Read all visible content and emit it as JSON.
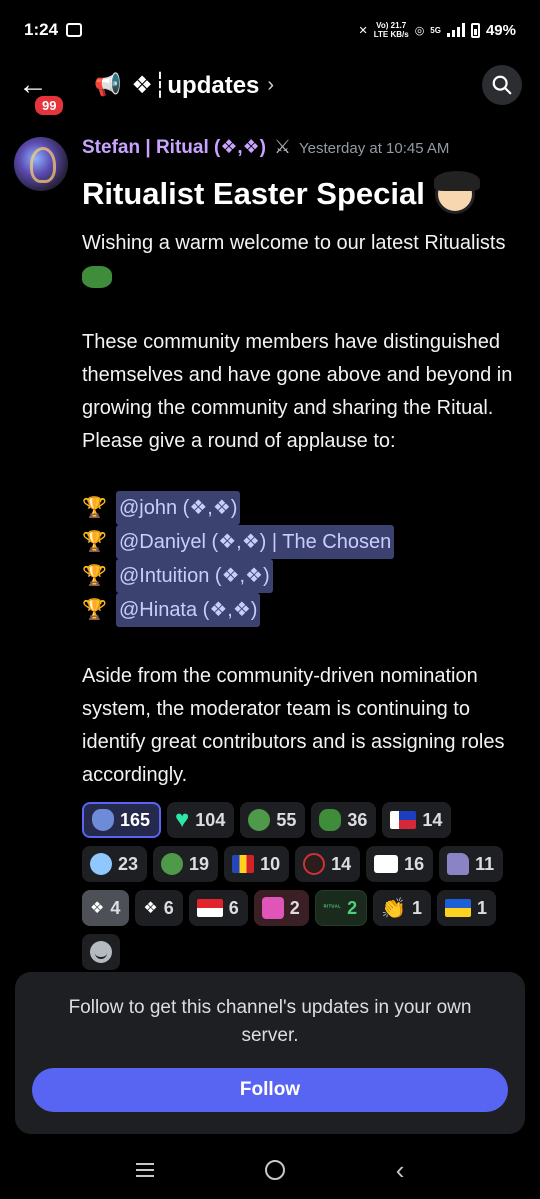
{
  "status_bar": {
    "time": "1:24",
    "network_top": "Vo) 21.7",
    "network_bottom": "LTE KB/s",
    "signal_label": "5G",
    "battery": "49%"
  },
  "header": {
    "unread_badge": "99",
    "channel_name": "❖┆updates",
    "chevron": "›"
  },
  "message": {
    "author": "Stefan | Ritual (❖,❖)",
    "author_badge": "⚔",
    "timestamp": "Yesterday at 10:45 AM",
    "title": "Ritualist Easter Special",
    "paragraph_1": "Wishing a warm welcome to our latest Ritualists",
    "paragraph_2": "These community members have distinguished themselves and have gone above and beyond in growing the community and sharing the Ritual. Please give a round of applause to:",
    "mentions": [
      {
        "prefix": "",
        "mention": "@john (❖,❖)",
        "suffix": ""
      },
      {
        "prefix": "",
        "mention": "@Daniyel (❖,❖) | The Chosen",
        "suffix": ""
      },
      {
        "prefix": "",
        "mention": "@Intuition (❖,❖)",
        "suffix": ""
      },
      {
        "prefix": "",
        "mention": "@Hinata (❖,❖)",
        "suffix": ""
      }
    ],
    "paragraph_3": "Aside from the community-driven nomination system, the moderator team is continuing to identify great contributors and is assigning roles accordingly."
  },
  "reactions": [
    {
      "icon": "ritual-hand",
      "count": "165",
      "active": true
    },
    {
      "icon": "green-heart",
      "count": "104"
    },
    {
      "icon": "frog-face",
      "count": "55"
    },
    {
      "icon": "pepe-frog",
      "count": "36"
    },
    {
      "icon": "philippines-flag",
      "count": "14"
    },
    {
      "icon": "blue-character",
      "count": "23"
    },
    {
      "icon": "pepe-smile",
      "count": "19"
    },
    {
      "icon": "romania-flag",
      "count": "10"
    },
    {
      "icon": "dark-crew",
      "count": "14"
    },
    {
      "icon": "i-love-you-tv",
      "count": "16"
    },
    {
      "icon": "paper-ghost",
      "count": "11"
    },
    {
      "icon": "ritual-knot",
      "count": "4"
    },
    {
      "icon": "ritual-knot-small",
      "count": "6"
    },
    {
      "icon": "indonesia-flag",
      "count": "6"
    },
    {
      "icon": "pink-pacman",
      "count": "2"
    },
    {
      "icon": "ritual-wordmark",
      "label": "ᴿᴵᵀᵁᴬᴸ",
      "count": "2"
    },
    {
      "icon": "clapping-hands",
      "count": "1"
    },
    {
      "icon": "ukraine-flag",
      "count": "1"
    }
  ],
  "follow_panel": {
    "text": "Follow to get this channel's updates in your own server.",
    "button": "Follow"
  },
  "colors": {
    "accent": "#5865f2",
    "author": "#c9a4ff",
    "mention_bg": "#3c4270",
    "badge": "#e5343c"
  }
}
